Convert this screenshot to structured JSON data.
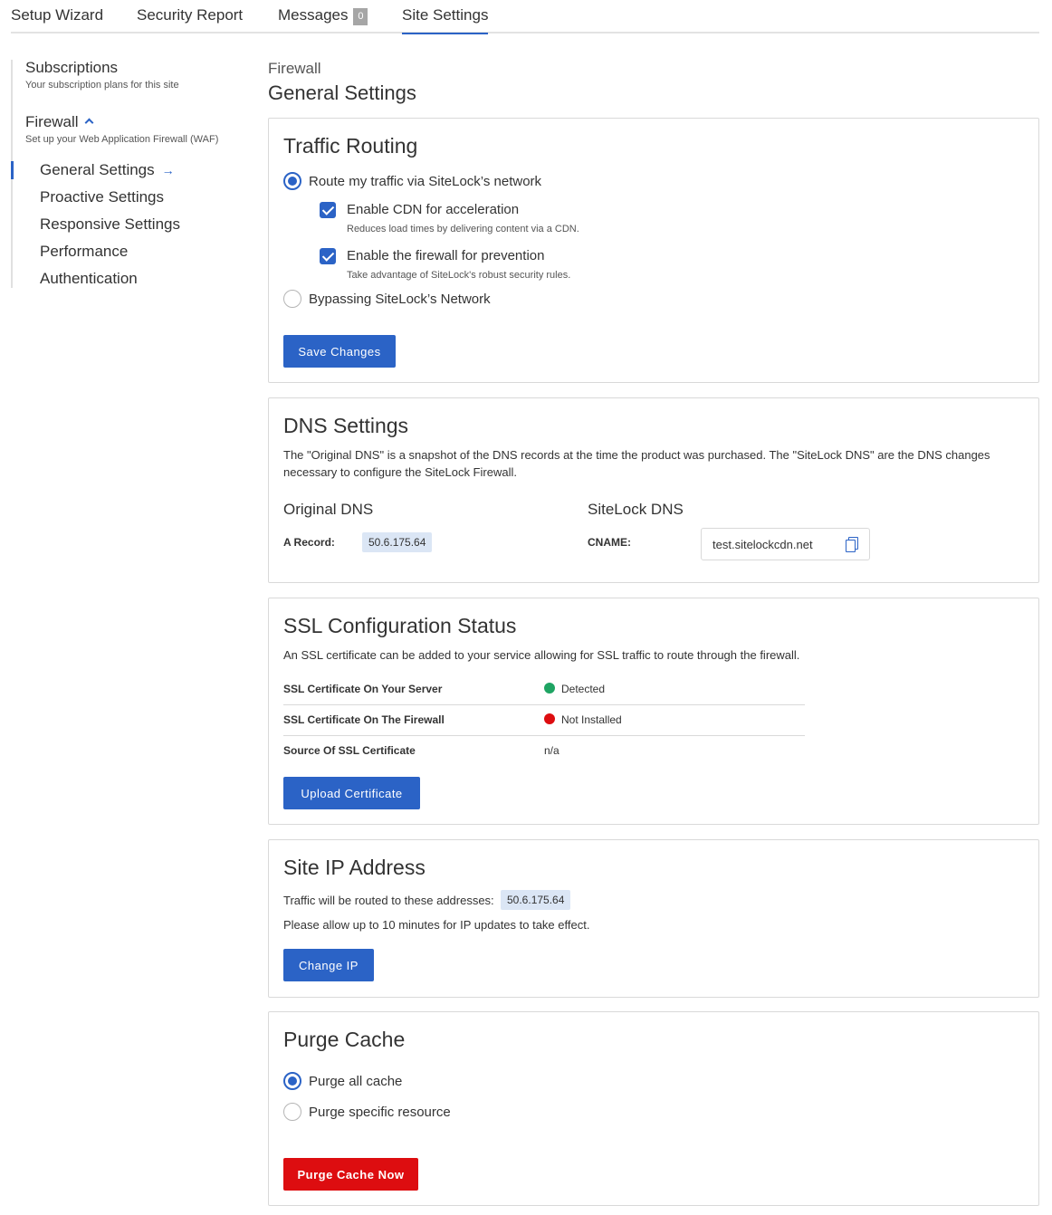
{
  "tabs": [
    {
      "label": "Setup Wizard"
    },
    {
      "label": "Security Report"
    },
    {
      "label": "Messages",
      "badge": "0"
    },
    {
      "label": "Site Settings",
      "active": true
    }
  ],
  "sidebar": {
    "subscriptions": {
      "label": "Subscriptions",
      "sub": "Your subscription plans for this site"
    },
    "firewall": {
      "label": "Firewall",
      "sub": "Set up your Web Application Firewall (WAF)"
    },
    "items": [
      {
        "label": "General Settings",
        "active": true
      },
      {
        "label": "Proactive Settings"
      },
      {
        "label": "Responsive Settings"
      },
      {
        "label": "Performance"
      },
      {
        "label": "Authentication"
      }
    ]
  },
  "page": {
    "breadcrumb": "Firewall",
    "title": "General Settings"
  },
  "traffic": {
    "title": "Traffic Routing",
    "route_label": "Route my traffic via SiteLock’s network",
    "cdn_label": "Enable CDN for acceleration",
    "cdn_hint": "Reduces load times by delivering content via a CDN.",
    "fw_label": "Enable the firewall for prevention",
    "fw_hint": "Take advantage of SiteLock's robust security rules.",
    "bypass_label": "Bypassing SiteLock’s Network",
    "save_label": "Save Changes"
  },
  "dns": {
    "title": "DNS Settings",
    "desc": "The \"Original DNS\" is a snapshot of the DNS records at the time the product was purchased. The \"SiteLock DNS\" are the DNS changes necessary to configure the SiteLock Firewall.",
    "original_heading": "Original DNS",
    "sitelock_heading": "SiteLock DNS",
    "a_record_label": "A Record:",
    "a_record_value": "50.6.175.64",
    "cname_label": "CNAME:",
    "cname_value": "test.sitelockcdn.net"
  },
  "ssl": {
    "title": "SSL Configuration Status",
    "desc": "An SSL certificate can be added to your service allowing for SSL traffic to route through the firewall.",
    "rows": [
      {
        "key": "SSL Certificate On Your Server",
        "value": "Detected",
        "status_color": "#1fa463"
      },
      {
        "key": "SSL Certificate On The Firewall",
        "value": "Not Installed",
        "status_color": "#dd0d10"
      },
      {
        "key": "Source Of SSL Certificate",
        "value": "n/a"
      }
    ],
    "upload_label": "Upload Certificate"
  },
  "siteip": {
    "title": "Site IP Address",
    "routed_text": "Traffic will be routed to these addresses:",
    "ip": "50.6.175.64",
    "note": "Please allow up to 10 minutes for IP updates to take effect.",
    "change_label": "Change IP"
  },
  "purge": {
    "title": "Purge Cache",
    "all_label": "Purge all cache",
    "specific_label": "Purge specific resource",
    "button_label": "Purge Cache Now"
  },
  "colors": {
    "accent": "#2b63c6",
    "danger": "#dd0d10",
    "success": "#1fa463",
    "pill_bg": "#dbe6f5"
  }
}
